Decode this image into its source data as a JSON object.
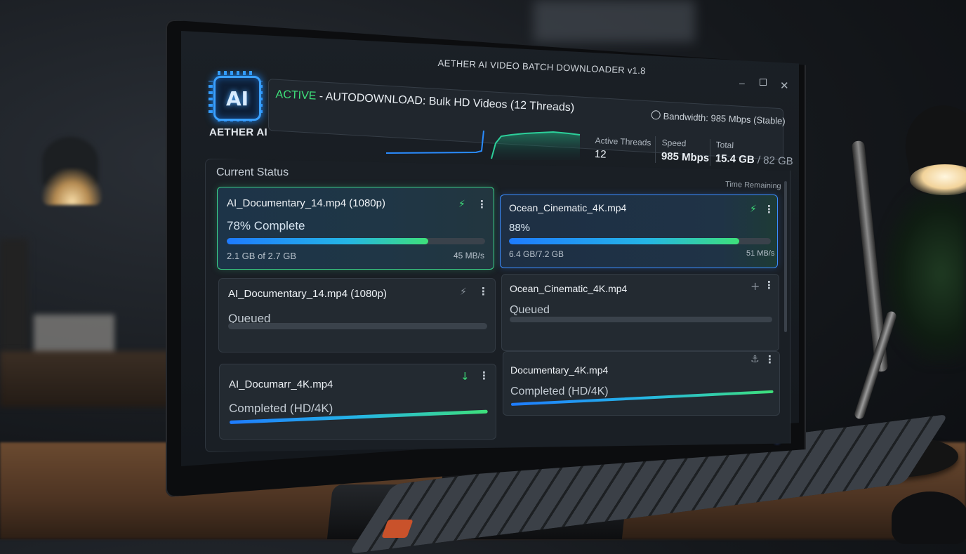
{
  "window": {
    "title": "AETHER AI VIDEO BATCH DOWNLOADER v1.8"
  },
  "brand": {
    "logo_text": "AI",
    "name": "AETHER AI",
    "accent": "#3aa0ff"
  },
  "status": {
    "state": "ACTIVE",
    "separator": " - ",
    "description": "AUTODOWNLOAD: Bulk HD Videos (12 Threads)",
    "bandwidth": "Bandwidth: 985 Mbps (Stable)",
    "state_color": "#3ee07a"
  },
  "stats": {
    "active_threads_label": "Active Threads",
    "active_threads_value": "12",
    "speed_label": "Speed",
    "speed_value": "985 Mbps",
    "total_label": "Total",
    "total_done": "15.4 GB",
    "total_rest": " / 82 GB"
  },
  "panel": {
    "title": "Current Status",
    "time_remaining_label": "Time Remaining"
  },
  "downloads": [
    {
      "filename": "AI_Documentary_14.mp4 (1080p)",
      "progress_label": "78% Complete",
      "progress": 0.78,
      "size": "2.1 GB of 2.7 GB",
      "rate": "45 MB/s",
      "icon": "bolt-icon"
    },
    {
      "filename": "Ocean_Cinematic_4K.mp4",
      "progress_label": "88%",
      "progress": 0.88,
      "size": "6.4 GB/7.2 GB",
      "rate": "51 MB/s",
      "icon": "bolt-icon"
    },
    {
      "filename": "AI_Documentary_14.mp4 (1080p)",
      "state": "Queued",
      "icon": "bolt-icon"
    },
    {
      "filename": "Ocean_Cinematic_4K.mp4",
      "state": "Queued",
      "icon": "plus-icon"
    },
    {
      "filename": "AI_Documarr_4K.mp4",
      "state": "Completed (HD/4K)",
      "icon": "download-arrow-icon"
    },
    {
      "filename": "Documentary_4K.mp4",
      "state": "Completed (HD/4K)",
      "icon": "anchor-icon"
    }
  ]
}
